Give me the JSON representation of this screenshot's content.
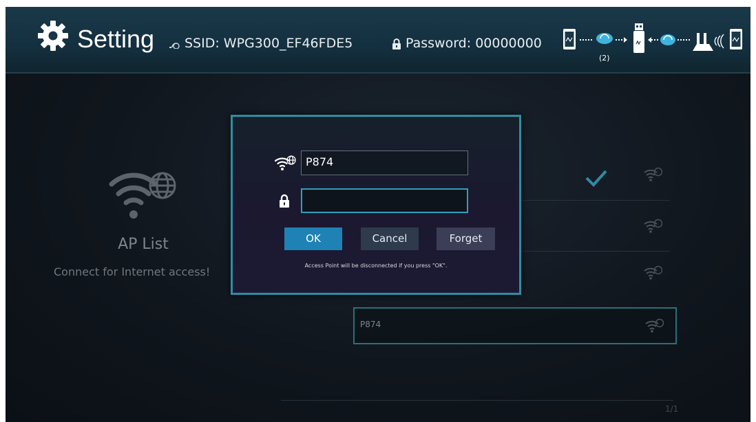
{
  "header": {
    "title": "Setting",
    "ssid_label": "SSID: WPG300_EF46FDE5",
    "password_label": "Password: 00000000",
    "diagram_step": "(2)"
  },
  "main": {
    "ap_list_title": "AP List",
    "ap_list_subtitle": "Connect for Internet access!",
    "selected_network": "P874",
    "page_indicator": "1/1"
  },
  "dialog": {
    "ssid_value": "P874",
    "password_value": "",
    "ok_label": "OK",
    "cancel_label": "Cancel",
    "forget_label": "Forget",
    "note": "Access Point will be disconnected if you press \"OK\"."
  },
  "colors": {
    "accent": "#2b8fa5",
    "ok_button": "#1e82b5",
    "check": "#2f8ca3"
  },
  "icons": [
    "gear-icon",
    "wifi-globe-icon",
    "lock-icon",
    "check-icon",
    "phone-icon",
    "usb-dongle-icon",
    "router-icon"
  ]
}
